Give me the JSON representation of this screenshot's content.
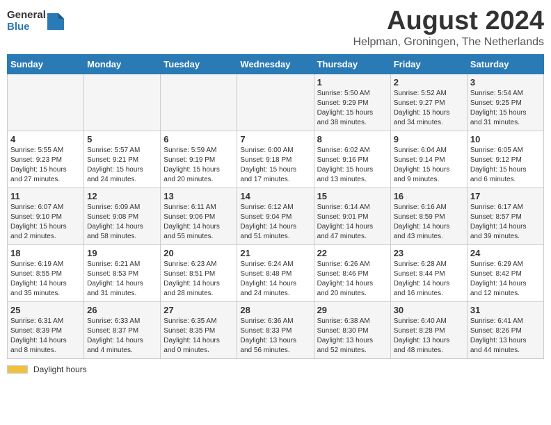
{
  "logo": {
    "general": "General",
    "blue": "Blue"
  },
  "title": "August 2024",
  "location": "Helpman, Groningen, The Netherlands",
  "days_of_week": [
    "Sunday",
    "Monday",
    "Tuesday",
    "Wednesday",
    "Thursday",
    "Friday",
    "Saturday"
  ],
  "footer": {
    "daylight_label": "Daylight hours"
  },
  "weeks": [
    [
      {
        "day": "",
        "info": ""
      },
      {
        "day": "",
        "info": ""
      },
      {
        "day": "",
        "info": ""
      },
      {
        "day": "",
        "info": ""
      },
      {
        "day": "1",
        "info": "Sunrise: 5:50 AM\nSunset: 9:29 PM\nDaylight: 15 hours\nand 38 minutes."
      },
      {
        "day": "2",
        "info": "Sunrise: 5:52 AM\nSunset: 9:27 PM\nDaylight: 15 hours\nand 34 minutes."
      },
      {
        "day": "3",
        "info": "Sunrise: 5:54 AM\nSunset: 9:25 PM\nDaylight: 15 hours\nand 31 minutes."
      }
    ],
    [
      {
        "day": "4",
        "info": "Sunrise: 5:55 AM\nSunset: 9:23 PM\nDaylight: 15 hours\nand 27 minutes."
      },
      {
        "day": "5",
        "info": "Sunrise: 5:57 AM\nSunset: 9:21 PM\nDaylight: 15 hours\nand 24 minutes."
      },
      {
        "day": "6",
        "info": "Sunrise: 5:59 AM\nSunset: 9:19 PM\nDaylight: 15 hours\nand 20 minutes."
      },
      {
        "day": "7",
        "info": "Sunrise: 6:00 AM\nSunset: 9:18 PM\nDaylight: 15 hours\nand 17 minutes."
      },
      {
        "day": "8",
        "info": "Sunrise: 6:02 AM\nSunset: 9:16 PM\nDaylight: 15 hours\nand 13 minutes."
      },
      {
        "day": "9",
        "info": "Sunrise: 6:04 AM\nSunset: 9:14 PM\nDaylight: 15 hours\nand 9 minutes."
      },
      {
        "day": "10",
        "info": "Sunrise: 6:05 AM\nSunset: 9:12 PM\nDaylight: 15 hours\nand 6 minutes."
      }
    ],
    [
      {
        "day": "11",
        "info": "Sunrise: 6:07 AM\nSunset: 9:10 PM\nDaylight: 15 hours\nand 2 minutes."
      },
      {
        "day": "12",
        "info": "Sunrise: 6:09 AM\nSunset: 9:08 PM\nDaylight: 14 hours\nand 58 minutes."
      },
      {
        "day": "13",
        "info": "Sunrise: 6:11 AM\nSunset: 9:06 PM\nDaylight: 14 hours\nand 55 minutes."
      },
      {
        "day": "14",
        "info": "Sunrise: 6:12 AM\nSunset: 9:04 PM\nDaylight: 14 hours\nand 51 minutes."
      },
      {
        "day": "15",
        "info": "Sunrise: 6:14 AM\nSunset: 9:01 PM\nDaylight: 14 hours\nand 47 minutes."
      },
      {
        "day": "16",
        "info": "Sunrise: 6:16 AM\nSunset: 8:59 PM\nDaylight: 14 hours\nand 43 minutes."
      },
      {
        "day": "17",
        "info": "Sunrise: 6:17 AM\nSunset: 8:57 PM\nDaylight: 14 hours\nand 39 minutes."
      }
    ],
    [
      {
        "day": "18",
        "info": "Sunrise: 6:19 AM\nSunset: 8:55 PM\nDaylight: 14 hours\nand 35 minutes."
      },
      {
        "day": "19",
        "info": "Sunrise: 6:21 AM\nSunset: 8:53 PM\nDaylight: 14 hours\nand 31 minutes."
      },
      {
        "day": "20",
        "info": "Sunrise: 6:23 AM\nSunset: 8:51 PM\nDaylight: 14 hours\nand 28 minutes."
      },
      {
        "day": "21",
        "info": "Sunrise: 6:24 AM\nSunset: 8:48 PM\nDaylight: 14 hours\nand 24 minutes."
      },
      {
        "day": "22",
        "info": "Sunrise: 6:26 AM\nSunset: 8:46 PM\nDaylight: 14 hours\nand 20 minutes."
      },
      {
        "day": "23",
        "info": "Sunrise: 6:28 AM\nSunset: 8:44 PM\nDaylight: 14 hours\nand 16 minutes."
      },
      {
        "day": "24",
        "info": "Sunrise: 6:29 AM\nSunset: 8:42 PM\nDaylight: 14 hours\nand 12 minutes."
      }
    ],
    [
      {
        "day": "25",
        "info": "Sunrise: 6:31 AM\nSunset: 8:39 PM\nDaylight: 14 hours\nand 8 minutes."
      },
      {
        "day": "26",
        "info": "Sunrise: 6:33 AM\nSunset: 8:37 PM\nDaylight: 14 hours\nand 4 minutes."
      },
      {
        "day": "27",
        "info": "Sunrise: 6:35 AM\nSunset: 8:35 PM\nDaylight: 14 hours\nand 0 minutes."
      },
      {
        "day": "28",
        "info": "Sunrise: 6:36 AM\nSunset: 8:33 PM\nDaylight: 13 hours\nand 56 minutes."
      },
      {
        "day": "29",
        "info": "Sunrise: 6:38 AM\nSunset: 8:30 PM\nDaylight: 13 hours\nand 52 minutes."
      },
      {
        "day": "30",
        "info": "Sunrise: 6:40 AM\nSunset: 8:28 PM\nDaylight: 13 hours\nand 48 minutes."
      },
      {
        "day": "31",
        "info": "Sunrise: 6:41 AM\nSunset: 8:26 PM\nDaylight: 13 hours\nand 44 minutes."
      }
    ]
  ]
}
